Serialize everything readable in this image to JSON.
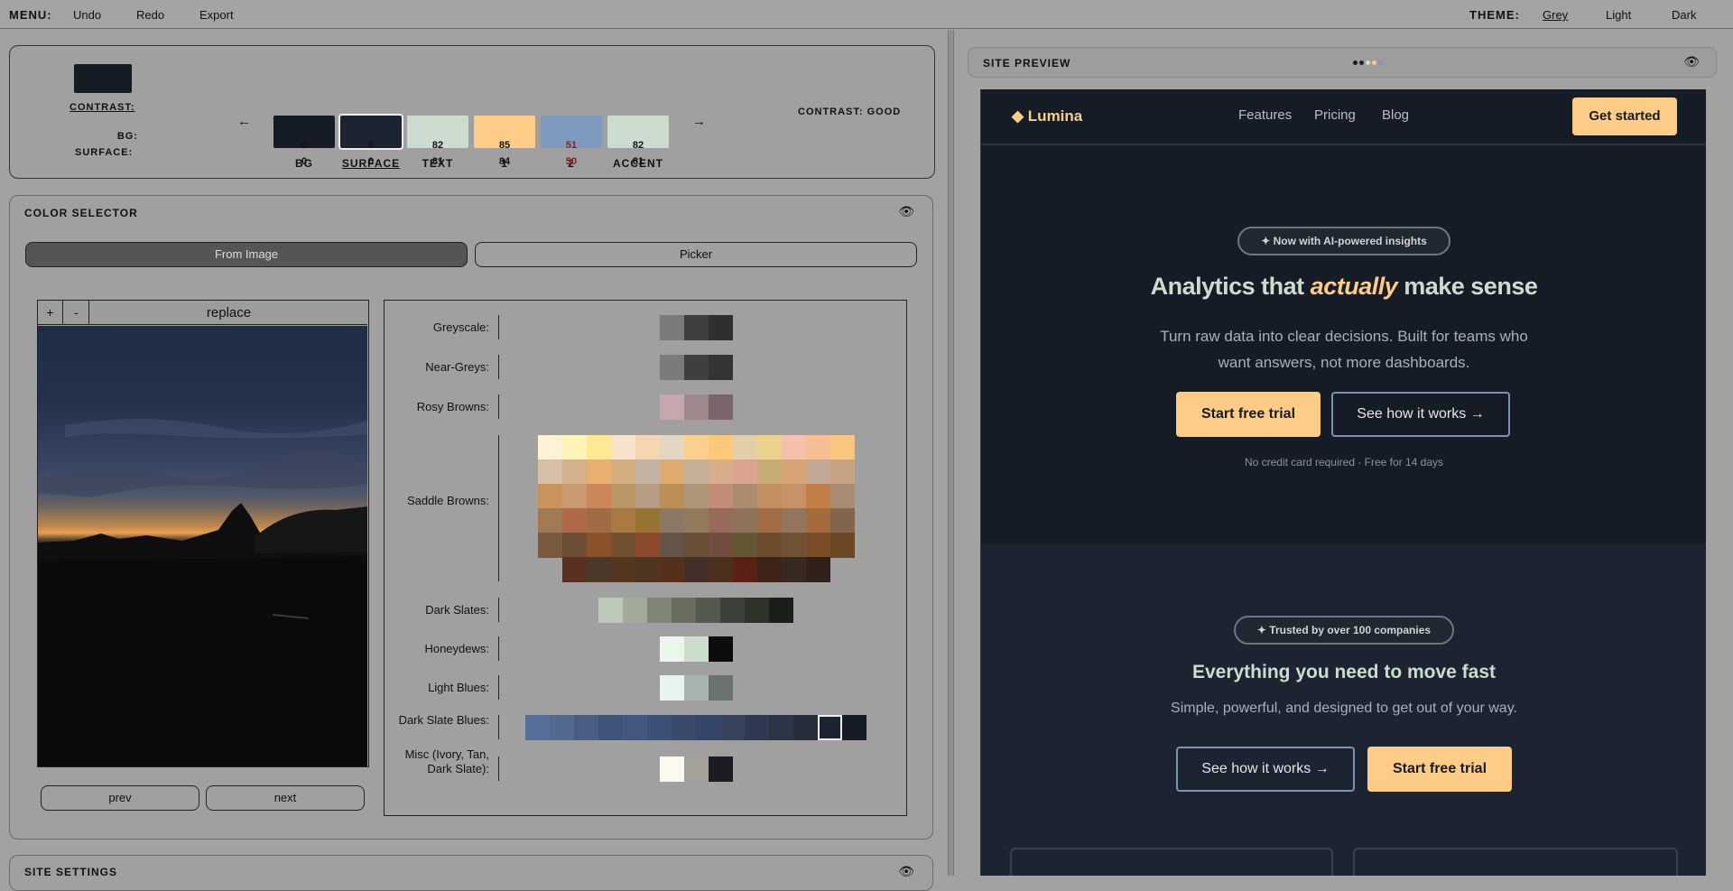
{
  "menubar": {
    "menu_label": "MENU:",
    "items": [
      "Undo",
      "Redo",
      "Export"
    ],
    "theme_label": "THEME:",
    "themes": [
      "Grey",
      "Light",
      "Dark"
    ],
    "active_theme": "Grey"
  },
  "palette": {
    "contrast_label": "CONTRAST:",
    "bg_label": "BG:",
    "surface_label": "SURFACE:",
    "contrast_status": "CONTRAST: GOOD",
    "prev_arrow": "←",
    "next_arrow": "→",
    "preview_color": "#151c26",
    "columns": [
      {
        "label": "BG",
        "color": "#151c26",
        "bg": "0",
        "surface": "0"
      },
      {
        "label": "SURFACE",
        "color": "#1b2430",
        "bg": "0",
        "surface": "0"
      },
      {
        "label": "TEXT",
        "color": "#ccdccf",
        "bg": "82",
        "surface": "81"
      },
      {
        "label": "1",
        "color": "#fdcd87",
        "bg": "85",
        "surface": "84"
      },
      {
        "label": "2",
        "color": "#7f9abf",
        "bg": "51",
        "surface": "50"
      },
      {
        "label": "ACCENT",
        "color": "#ccdccf",
        "bg": "82",
        "surface": "81"
      }
    ]
  },
  "color_selector": {
    "title": "COLOR SELECTOR",
    "tabs": [
      "From Image",
      "Picker"
    ],
    "active_tab": "From Image",
    "zoom_in": "+",
    "zoom_out": "-",
    "replace_label": "replace",
    "prev_label": "prev",
    "next_label": "next",
    "groups": [
      {
        "name": "Greyscale:",
        "colors": [
          "#7b7b7b",
          "#3f3f3f",
          "#2f2f2f"
        ]
      },
      {
        "name": "Near-Greys:",
        "colors": [
          "#7b7b7b",
          "#3f3f3f",
          "#343434"
        ]
      },
      {
        "name": "Rosy Browns:",
        "colors": [
          "#c7a7ae",
          "#9e888c",
          "#7c646c"
        ]
      },
      {
        "name": "Saddle Browns:",
        "rows": [
          [
            "#fff2d5",
            "#fff5ba",
            "#fde993",
            "#f8e2cb",
            "#f5d6b1",
            "#e2d7c2",
            "#f9d08d",
            "#fdc978",
            "#e2cea9",
            "#ecd38b",
            "#f5c1aa",
            "#f5bf93",
            "#f8c67e"
          ],
          [
            "#d8c0a6",
            "#d3b18c",
            "#e9b171",
            "#d3ad7c",
            "#c4b3a2",
            "#dfab6f",
            "#c5b19b",
            "#d7ae8c",
            "#dba48e",
            "#c5ac76",
            "#d7a473",
            "#c0a996",
            "#c4a283"
          ],
          [
            "#c8945c",
            "#c99a73",
            "#cc865a",
            "#b99666",
            "#b59c82",
            "#bb8f56",
            "#ae9778",
            "#c28c77",
            "#ad8b6d",
            "#c19062",
            "#c79268",
            "#c27f45",
            "#a78c73"
          ],
          [
            "#9f7a55",
            "#b0694a",
            "#9f6c45",
            "#a87a41",
            "#987432",
            "#8c7866",
            "#927a5d",
            "#986a5b",
            "#8f7358",
            "#a16c46",
            "#93765e",
            "#a56b3c",
            "#83654d"
          ],
          [
            "#7a5a3f",
            "#6d4e34",
            "#8a522b",
            "#70502f",
            "#8b4a2c",
            "#655449",
            "#6a4f39",
            "#734d40",
            "#645734",
            "#6e4b2d",
            "#705236",
            "#7a4d29",
            "#6b4725"
          ],
          [
            "",
            "#5a3121",
            "#4b3a2c",
            "#53381f",
            "#4d3522",
            "#56301c",
            "#432f28",
            "#4d2f1e",
            "#5a2016",
            "#3e2418",
            "#372820",
            "#30211a",
            ""
          ]
        ]
      },
      {
        "name": "Dark Slates:",
        "colors": [
          "#bcc8b8",
          "#a2aa9c",
          "#7f8678",
          "#6a6e5e",
          "#545a4e",
          "#3c4139",
          "#2e3329",
          "#1b1f19"
        ]
      },
      {
        "name": "Honeydews:",
        "colors": [
          "#edf6ec",
          "#ccdccf",
          "#0d0d0d"
        ]
      },
      {
        "name": "Light Blues:",
        "colors": [
          "#e8f4f2",
          "#a8b4ae",
          "#6a7272"
        ]
      },
      {
        "name": "Dark Slate Blues:",
        "colors": [
          "#566f98",
          "#536990",
          "#4b5d84",
          "#40547a",
          "#445781",
          "#3d5078",
          "#394a6c",
          "#34456a",
          "#37425d",
          "#2f3a52",
          "#2c3448",
          "#262d3b",
          "#1b2430",
          "#151c26"
        ],
        "selected_index": 12
      },
      {
        "name": "Misc (Ivory, Tan, Dark Slate):",
        "colors": [
          "#fcfaee",
          "#a3a199",
          "#1c1c22"
        ]
      }
    ]
  },
  "site_settings": {
    "title": "SITE SETTINGS"
  },
  "preview": {
    "title": "SITE PREVIEW",
    "site": {
      "logo": "◆ Lumina",
      "nav": [
        "Features",
        "Pricing",
        "Blog"
      ],
      "cta": "Get started",
      "hero_badge": "✦ Now with AI-powered insights",
      "hero_title_before": "Analytics that ",
      "hero_title_em": "actually",
      "hero_title_after": " make sense",
      "hero_sub": "Turn raw data into clear decisions. Built for teams who want answers, not more dashboards.",
      "hero_primary": "Start free trial",
      "hero_secondary": "See how it works →",
      "hero_note": "No credit card required · Free for 14 days",
      "sec_badge": "✦ Trusted by over 100 companies",
      "sec_title": "Everything you need to move fast",
      "sec_sub": "Simple, powerful, and designed to get out of your way.",
      "sec_outline": "See how it works →",
      "sec_primary": "Start free trial"
    }
  }
}
